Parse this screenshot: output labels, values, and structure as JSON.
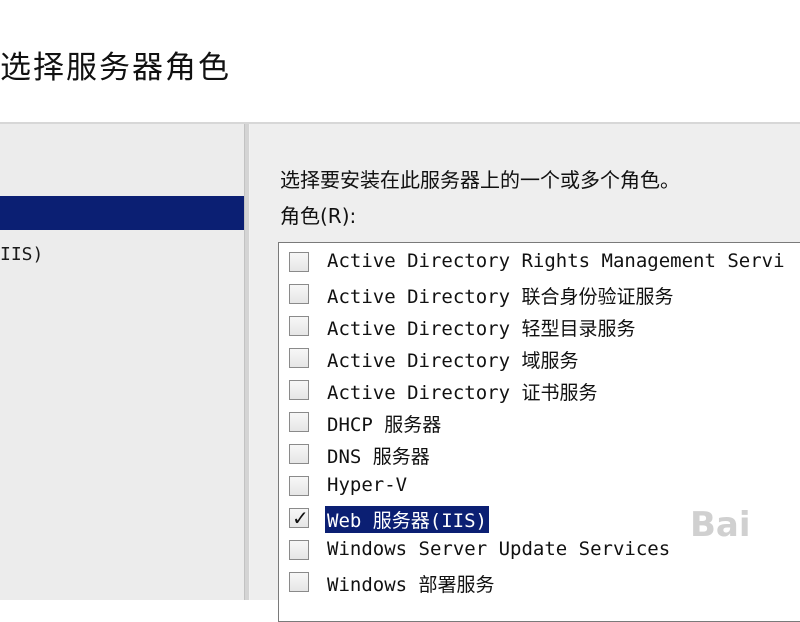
{
  "page": {
    "title": "选择服务器角色"
  },
  "sidebar": {
    "item_partial_label": "IIS)"
  },
  "main": {
    "instruction": "选择要安装在此服务器上的一个或多个角色。",
    "roles_label": "角色(R):",
    "roles": [
      {
        "label": "Active Directory Rights Management Servi",
        "checked": false,
        "selected": false
      },
      {
        "label": "Active Directory 联合身份验证服务",
        "checked": false,
        "selected": false
      },
      {
        "label": "Active Directory 轻型目录服务",
        "checked": false,
        "selected": false
      },
      {
        "label": "Active Directory 域服务",
        "checked": false,
        "selected": false
      },
      {
        "label": "Active Directory 证书服务",
        "checked": false,
        "selected": false
      },
      {
        "label": "DHCP 服务器",
        "checked": false,
        "selected": false
      },
      {
        "label": "DNS 服务器",
        "checked": false,
        "selected": false
      },
      {
        "label": "Hyper-V",
        "checked": false,
        "selected": false
      },
      {
        "label": "Web 服务器(IIS)",
        "checked": true,
        "selected": true
      },
      {
        "label": "Windows Server Update Services",
        "checked": false,
        "selected": false
      },
      {
        "label": "Windows 部署服务",
        "checked": false,
        "selected": false
      }
    ]
  },
  "watermark": "Bai"
}
